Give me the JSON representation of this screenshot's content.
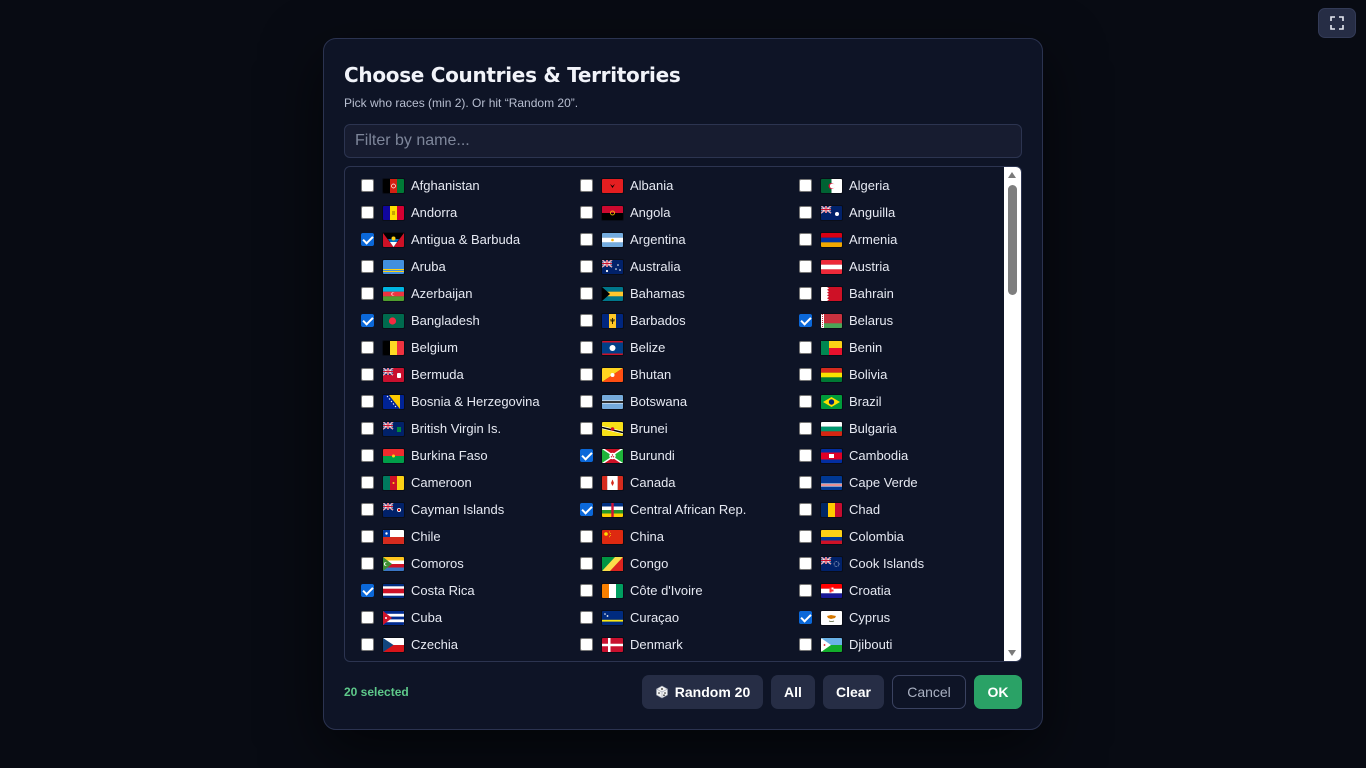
{
  "header": {
    "fullscreen_icon": "expand-icon"
  },
  "modal": {
    "title": "Choose Countries & Territories",
    "subtitle": "Pick who races (min 2). Or hit “Random 20”.",
    "filter_placeholder": "Filter by name...",
    "selected_count": "20 selected",
    "buttons": {
      "random": "Random 20",
      "all": "All",
      "clear": "Clear",
      "cancel": "Cancel",
      "ok": "OK"
    }
  },
  "countries": [
    {
      "name": "Afghanistan",
      "checked": false,
      "flag": "af"
    },
    {
      "name": "Albania",
      "checked": false,
      "flag": "al"
    },
    {
      "name": "Algeria",
      "checked": false,
      "flag": "dz"
    },
    {
      "name": "Andorra",
      "checked": false,
      "flag": "ad"
    },
    {
      "name": "Angola",
      "checked": false,
      "flag": "ao"
    },
    {
      "name": "Anguilla",
      "checked": false,
      "flag": "ai"
    },
    {
      "name": "Antigua & Barbuda",
      "checked": true,
      "flag": "ag"
    },
    {
      "name": "Argentina",
      "checked": false,
      "flag": "ar"
    },
    {
      "name": "Armenia",
      "checked": false,
      "flag": "am"
    },
    {
      "name": "Aruba",
      "checked": false,
      "flag": "aw"
    },
    {
      "name": "Australia",
      "checked": false,
      "flag": "au"
    },
    {
      "name": "Austria",
      "checked": false,
      "flag": "at"
    },
    {
      "name": "Azerbaijan",
      "checked": false,
      "flag": "az"
    },
    {
      "name": "Bahamas",
      "checked": false,
      "flag": "bs"
    },
    {
      "name": "Bahrain",
      "checked": false,
      "flag": "bh"
    },
    {
      "name": "Bangladesh",
      "checked": true,
      "flag": "bd"
    },
    {
      "name": "Barbados",
      "checked": false,
      "flag": "bb"
    },
    {
      "name": "Belarus",
      "checked": true,
      "flag": "by"
    },
    {
      "name": "Belgium",
      "checked": false,
      "flag": "be"
    },
    {
      "name": "Belize",
      "checked": false,
      "flag": "bz"
    },
    {
      "name": "Benin",
      "checked": false,
      "flag": "bj"
    },
    {
      "name": "Bermuda",
      "checked": false,
      "flag": "bm"
    },
    {
      "name": "Bhutan",
      "checked": false,
      "flag": "bt"
    },
    {
      "name": "Bolivia",
      "checked": false,
      "flag": "bo"
    },
    {
      "name": "Bosnia & Herzegovina",
      "checked": false,
      "flag": "ba"
    },
    {
      "name": "Botswana",
      "checked": false,
      "flag": "bw"
    },
    {
      "name": "Brazil",
      "checked": false,
      "flag": "br"
    },
    {
      "name": "British Virgin Is.",
      "checked": false,
      "flag": "vg"
    },
    {
      "name": "Brunei",
      "checked": false,
      "flag": "bn"
    },
    {
      "name": "Bulgaria",
      "checked": false,
      "flag": "bg"
    },
    {
      "name": "Burkina Faso",
      "checked": false,
      "flag": "bf"
    },
    {
      "name": "Burundi",
      "checked": true,
      "flag": "bi"
    },
    {
      "name": "Cambodia",
      "checked": false,
      "flag": "kh"
    },
    {
      "name": "Cameroon",
      "checked": false,
      "flag": "cm"
    },
    {
      "name": "Canada",
      "checked": false,
      "flag": "ca"
    },
    {
      "name": "Cape Verde",
      "checked": false,
      "flag": "cv"
    },
    {
      "name": "Cayman Islands",
      "checked": false,
      "flag": "ky"
    },
    {
      "name": "Central African Rep.",
      "checked": true,
      "flag": "cf"
    },
    {
      "name": "Chad",
      "checked": false,
      "flag": "td"
    },
    {
      "name": "Chile",
      "checked": false,
      "flag": "cl"
    },
    {
      "name": "China",
      "checked": false,
      "flag": "cn"
    },
    {
      "name": "Colombia",
      "checked": false,
      "flag": "co"
    },
    {
      "name": "Comoros",
      "checked": false,
      "flag": "km"
    },
    {
      "name": "Congo",
      "checked": false,
      "flag": "cg"
    },
    {
      "name": "Cook Islands",
      "checked": false,
      "flag": "ck"
    },
    {
      "name": "Costa Rica",
      "checked": true,
      "flag": "cr"
    },
    {
      "name": "Côte d'Ivoire",
      "checked": false,
      "flag": "ci"
    },
    {
      "name": "Croatia",
      "checked": false,
      "flag": "hr"
    },
    {
      "name": "Cuba",
      "checked": false,
      "flag": "cu"
    },
    {
      "name": "Curaçao",
      "checked": false,
      "flag": "cw"
    },
    {
      "name": "Cyprus",
      "checked": true,
      "flag": "cy"
    },
    {
      "name": "Czechia",
      "checked": false,
      "flag": "cz"
    },
    {
      "name": "Denmark",
      "checked": false,
      "flag": "dk"
    },
    {
      "name": "Djibouti",
      "checked": false,
      "flag": "dj"
    }
  ],
  "colors": {
    "background": "#080b13",
    "modal": "#0e1426",
    "accent_ok": "#2aa266",
    "selected_text": "#5ec98a",
    "checkbox_checked": "#0b68d9"
  }
}
